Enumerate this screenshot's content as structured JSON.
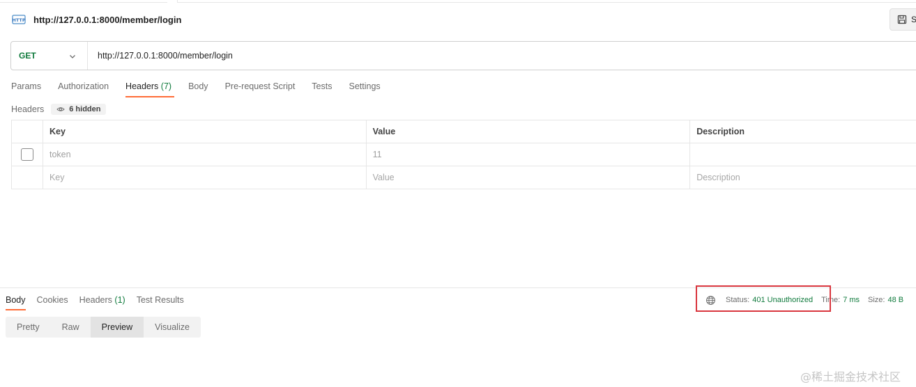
{
  "request": {
    "title": "http://127.0.0.1:8000/member/login",
    "save_label": "S",
    "method": "GET",
    "url": "http://127.0.0.1:8000/member/login"
  },
  "request_tabs": [
    {
      "label": "Params"
    },
    {
      "label": "Authorization"
    },
    {
      "label": "Headers",
      "count": "(7)",
      "active": true
    },
    {
      "label": "Body"
    },
    {
      "label": "Pre-request Script"
    },
    {
      "label": "Tests"
    },
    {
      "label": "Settings"
    }
  ],
  "headers_section": {
    "label": "Headers",
    "hidden_label": "6 hidden"
  },
  "headers_table": {
    "columns": [
      "Key",
      "Value",
      "Description"
    ],
    "rows": [
      {
        "key": "token",
        "value": "11",
        "description": ""
      }
    ],
    "placeholders": {
      "key": "Key",
      "value": "Value",
      "description": "Description"
    }
  },
  "response_tabs": [
    {
      "label": "Body",
      "active": true
    },
    {
      "label": "Cookies"
    },
    {
      "label": "Headers",
      "count": "(1)"
    },
    {
      "label": "Test Results"
    }
  ],
  "response_status": {
    "status_label": "Status:",
    "status_value": "401 Unauthorized",
    "time_label": "Time:",
    "time_value": "7 ms",
    "size_label": "Size:",
    "size_value": "48 B"
  },
  "view_modes": [
    {
      "label": "Pretty"
    },
    {
      "label": "Raw"
    },
    {
      "label": "Preview",
      "active": true
    },
    {
      "label": "Visualize"
    }
  ],
  "watermark": "@稀土掘金技术社区",
  "colors": {
    "accent": "#ff6c37",
    "method_get": "#0f7a3c",
    "status_ok_text": "#0f7a3c",
    "highlight": "#d9363e"
  }
}
